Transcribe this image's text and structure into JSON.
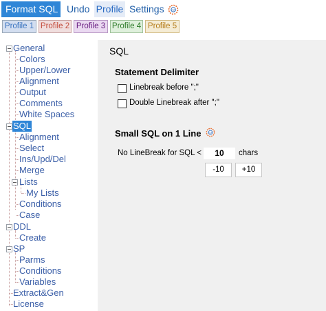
{
  "menu": {
    "format_sql": "Format SQL",
    "undo": "Undo",
    "profile": "Profile",
    "settings": "Settings"
  },
  "profiles": [
    "Profile 1",
    "Profile 2",
    "Profile 3",
    "Profile 4",
    "Profile 5"
  ],
  "tree": [
    {
      "label": "General"
    },
    {
      "label": "Colors"
    },
    {
      "label": "Upper/Lower"
    },
    {
      "label": "Alignment"
    },
    {
      "label": "Output"
    },
    {
      "label": "Comments"
    },
    {
      "label": "White Spaces"
    },
    {
      "label": "SQL",
      "selected": true
    },
    {
      "label": "Alignment"
    },
    {
      "label": "Select"
    },
    {
      "label": "Ins/Upd/Del"
    },
    {
      "label": "Merge"
    },
    {
      "label": "Lists"
    },
    {
      "label": "My Lists"
    },
    {
      "label": "Conditions"
    },
    {
      "label": "Case"
    },
    {
      "label": "DDL"
    },
    {
      "label": "Create"
    },
    {
      "label": "SP"
    },
    {
      "label": "Parms"
    },
    {
      "label": "Conditions"
    },
    {
      "label": "Variables"
    },
    {
      "label": "Extract&Gen"
    },
    {
      "label": "License"
    }
  ],
  "panel": {
    "title": "SQL",
    "statement_delimiter": {
      "heading": "Statement Delimiter",
      "linebreak_before": {
        "label": "Linebreak before \";\"",
        "checked": false
      },
      "double_linebreak_after": {
        "label": "Double Linebreak after \";\"",
        "checked": false
      }
    },
    "small_sql": {
      "heading": "Small SQL on 1 Line",
      "no_linebreak_label": "No LineBreak for  SQL <",
      "value": "10",
      "unit": "chars",
      "minus_button": "-10",
      "plus_button": "+10"
    }
  },
  "colors": {
    "accent": "#2f86d7",
    "panel_bg": "#f0f0f0",
    "tree_text": "#3b5fa8"
  }
}
